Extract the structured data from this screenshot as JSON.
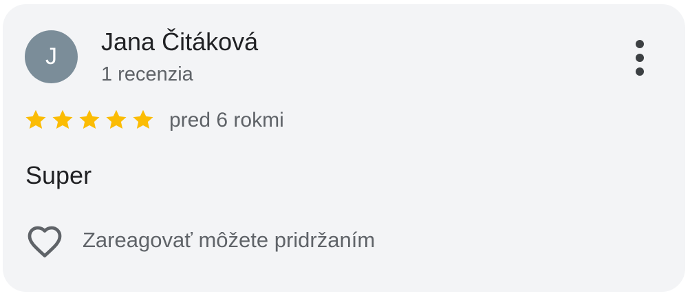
{
  "review": {
    "avatar_initial": "J",
    "author_name": "Jana Čitáková",
    "author_meta": "1 recenzia",
    "rating": 5,
    "rating_max": 5,
    "time_ago": "pred 6 rokmi",
    "text": "Super",
    "reaction_hint": "Zareagovať môžete pridržaním"
  },
  "icons": {
    "more": "more-vertical-icon",
    "star": "star-icon",
    "heart": "heart-outline-icon"
  },
  "colors": {
    "card_background": "#f3f4f6",
    "avatar_background": "#7b8d99",
    "star": "#fbbc04",
    "primary_text": "#202124",
    "secondary_text": "#5f6368"
  }
}
